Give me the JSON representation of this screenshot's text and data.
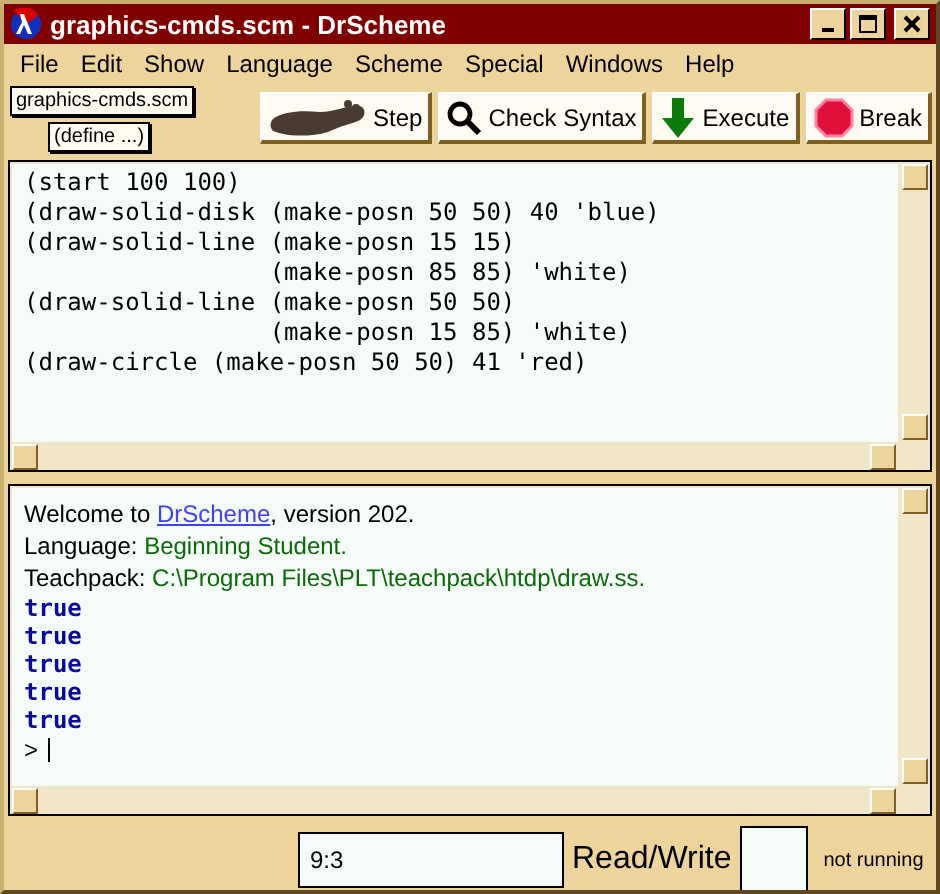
{
  "window": {
    "title": "graphics-cmds.scm - DrScheme"
  },
  "menu": [
    "File",
    "Edit",
    "Show",
    "Language",
    "Scheme",
    "Special",
    "Windows",
    "Help"
  ],
  "file_button": "graphics-cmds.scm",
  "define_button": "(define ...)",
  "toolbar": [
    {
      "kind": "step",
      "label": "Step"
    },
    {
      "kind": "check",
      "label": "Check Syntax"
    },
    {
      "kind": "execute",
      "label": "Execute"
    },
    {
      "kind": "break",
      "label": "Break"
    }
  ],
  "editor": {
    "lines": [
      "(start 100 100)",
      "(draw-solid-disk (make-posn 50 50) 40 'blue)",
      "(draw-solid-line (make-posn 15 15)",
      "                 (make-posn 85 85) 'white)",
      "(draw-solid-line (make-posn 50 50)",
      "                 (make-posn 15 85) 'white)",
      "(draw-circle (make-posn 50 50) 41 'red)"
    ]
  },
  "interactions": {
    "welcome": {
      "before": "Welcome to ",
      "link": "DrScheme",
      "after": ", version 202."
    },
    "info": [
      {
        "label": "Language: ",
        "value": "Beginning Student."
      },
      {
        "label": "Teachpack: ",
        "value": "C:\\Program Files\\PLT\\teachpack\\htdp\\draw.ss."
      }
    ],
    "results": [
      "true",
      "true",
      "true",
      "true",
      "true"
    ],
    "prompt": ">"
  },
  "status_bar": {
    "position": "9:3",
    "mode": "Read/Write",
    "state": "not running"
  }
}
